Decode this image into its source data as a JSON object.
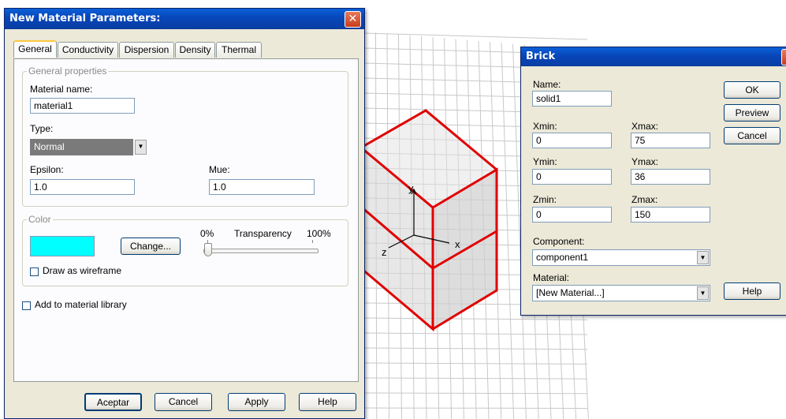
{
  "material_dialog": {
    "title": "New Material Parameters:",
    "close_glyph": "✕",
    "tabs": [
      "General",
      "Conductivity",
      "Dispersion",
      "Density",
      "Thermal"
    ],
    "active_tab": "General",
    "general_group": {
      "title": "General properties",
      "material_name_label": "Material name:",
      "material_name_value": "material1",
      "type_label": "Type:",
      "type_value": "Normal",
      "epsilon_label": "Epsilon:",
      "epsilon_value": "1.0",
      "mue_label": "Mue:",
      "mue_value": "1.0"
    },
    "color_group": {
      "title": "Color",
      "swatch_color": "#00ffff",
      "change_label": "Change...",
      "transparency_min": "0%",
      "transparency_label": "Transparency",
      "transparency_max": "100%",
      "transparency_value": 0,
      "wireframe_label": "Draw as wireframe",
      "wireframe_checked": false
    },
    "add_library_label": "Add to material library",
    "add_library_checked": false,
    "buttons": {
      "accept": "Aceptar",
      "cancel": "Cancel",
      "apply": "Apply",
      "help": "Help"
    }
  },
  "brick_dialog": {
    "title": "Brick",
    "close_glyph": "✕",
    "name_label": "Name:",
    "name_value": "solid1",
    "xmin_label": "Xmin:",
    "xmin_value": "0",
    "xmax_label": "Xmax:",
    "xmax_value": "75",
    "ymin_label": "Ymin:",
    "ymin_value": "0",
    "ymax_label": "Ymax:",
    "ymax_value": "36",
    "zmin_label": "Zmin:",
    "zmin_value": "0",
    "zmax_label": "Zmax:",
    "zmax_value": "150",
    "component_label": "Component:",
    "component_value": "component1",
    "material_label": "Material:",
    "material_value": "[New Material...]",
    "buttons": {
      "ok": "OK",
      "preview": "Preview",
      "cancel": "Cancel",
      "help": "Help"
    }
  },
  "viewport": {
    "axis_x": "x",
    "axis_y": "y",
    "axis_z": "z",
    "brick_edge_color": "#e00000",
    "brick_fill_color": "#c8c8c8",
    "grid_color": "#c8c8c8"
  }
}
